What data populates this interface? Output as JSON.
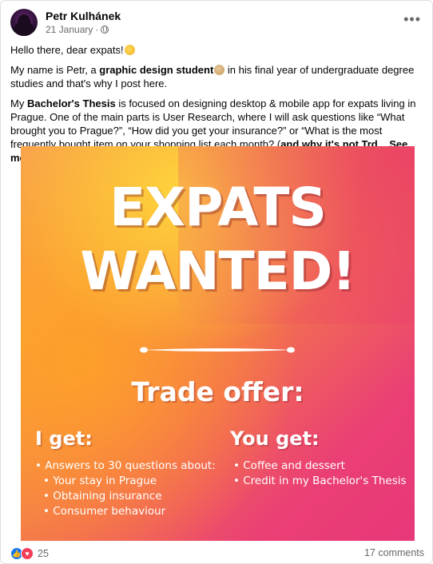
{
  "post": {
    "author": "Petr Kulhánek",
    "date": "21 January",
    "date_separator": "·",
    "privacy_icon": "globe-icon",
    "more_icon": "ellipsis-icon",
    "more_label": "•••",
    "text": {
      "p1": "Hello there, dear expats!",
      "p2_before": "My name is Petr, a ",
      "p2_bold": "graphic design student",
      "p2_after": " in his final year of undergraduate degree studies and that's why I post here.",
      "p3_before": "My ",
      "p3_bold": "Bachelor's Thesis",
      "p3_middle": " is focused on designing desktop & mobile app for expats living in Prague. One of the main parts is User Research, where I will ask questions like “What brought you to Prague?”, “How did you get your insurance?” or “What is the most frequently bought item on your shopping list each month? (",
      "p3_bold2": "and why it's not Trd",
      "p3_ellipsis": "...",
      "see_more": "See more"
    }
  },
  "poster": {
    "headline1": "EXPATS",
    "headline2": "WANTED!",
    "trade": "Trade offer:",
    "i_get": {
      "title": "I get:",
      "items": [
        {
          "text": "• Answers to 30 questions about:",
          "level": 0
        },
        {
          "text": "• Your stay in Prague",
          "level": 1
        },
        {
          "text": "• Obtaining insurance",
          "level": 1
        },
        {
          "text": "• Consumer behaviour",
          "level": 1
        }
      ]
    },
    "you_get": {
      "title": "You get:",
      "items": [
        {
          "text": "• Coffee and dessert",
          "level": 0
        },
        {
          "text": "• Credit in my Bachelor's Thesis",
          "level": 0
        }
      ]
    },
    "colors": {
      "gradient_start": "#f9a24c",
      "gradient_end": "#e7387a",
      "text": "#ffffff"
    }
  },
  "footer": {
    "reaction_icons": [
      "like-icon",
      "love-icon"
    ],
    "reaction_count": "25",
    "comments": "17 comments"
  }
}
